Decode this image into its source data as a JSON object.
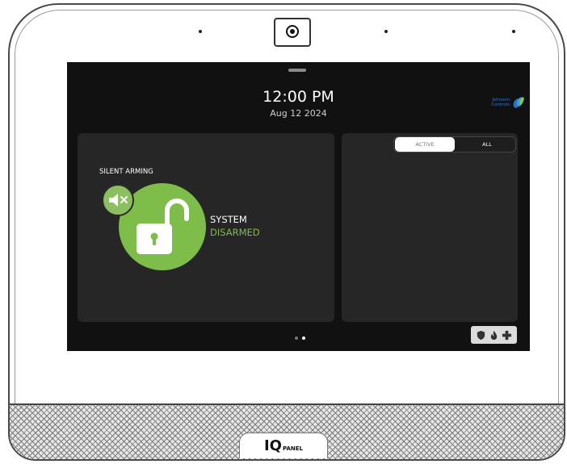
{
  "clock": {
    "time": "12:00 PM",
    "date": "Aug 12 2024"
  },
  "brand": {
    "logo_text": "Johnson Controls",
    "panel_mark": "IQ",
    "panel_text": "PANEL"
  },
  "security": {
    "silent_label": "SILENT ARMING",
    "status_line1": "SYSTEM",
    "status_line2": "DISARMED",
    "status_color": "#7ebd4a",
    "lock_icon": "unlocked-padlock-icon",
    "silent_icon": "speaker-muted-icon"
  },
  "filter_tabs": [
    {
      "label": "ACTIVE",
      "selected": true
    },
    {
      "label": "ALL",
      "selected": false
    }
  ],
  "pagination": {
    "pages": 2,
    "current": 2
  },
  "emergency": {
    "icons": [
      "shield-icon",
      "fire-icon",
      "medical-cross-icon"
    ]
  },
  "colors": {
    "screen_bg": "#111111",
    "panel_bg": "#262626",
    "accent_green": "#7ebd4a",
    "brand_blue": "#3b78c3"
  }
}
